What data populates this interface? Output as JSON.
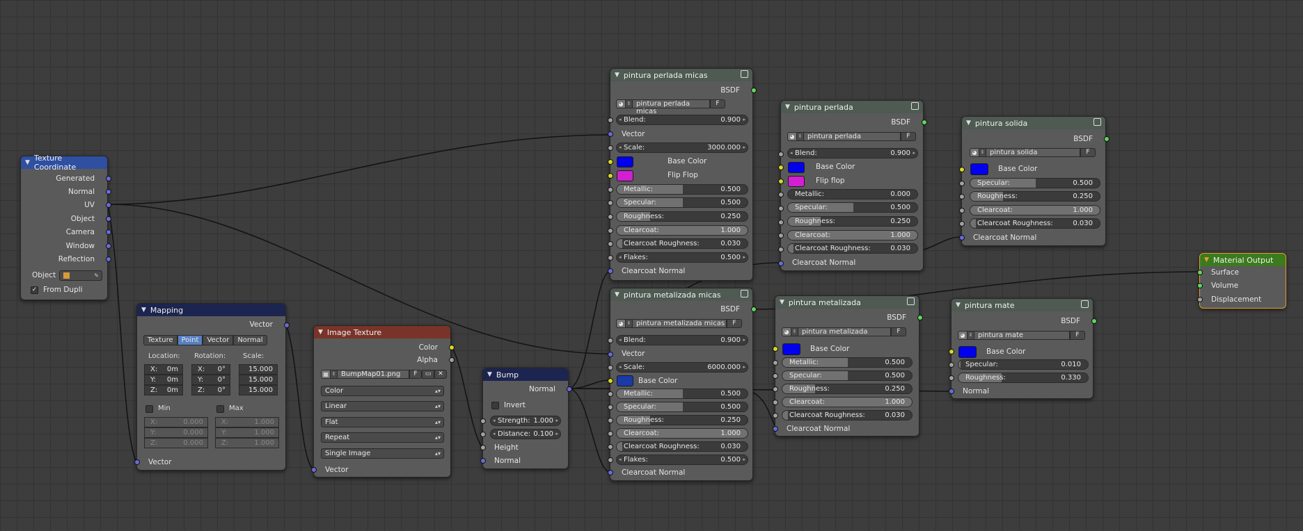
{
  "nodes": {
    "tex_coord": {
      "title": "Texture Coordinate",
      "outputs": [
        "Generated",
        "Normal",
        "UV",
        "Object",
        "Camera",
        "Window",
        "Reflection"
      ],
      "object_label": "Object",
      "from_dupli": "From Dupli"
    },
    "mapping": {
      "title": "Mapping",
      "output": "Vector",
      "tabs": [
        "Texture",
        "Point",
        "Vector",
        "Normal"
      ],
      "active_tab": "Point",
      "col_labels": [
        "Location:",
        "Rotation:",
        "Scale:"
      ],
      "location": [
        [
          "X:",
          "0m"
        ],
        [
          "Y:",
          "0m"
        ],
        [
          "Z:",
          "0m"
        ]
      ],
      "rotation": [
        [
          "X:",
          "0°"
        ],
        [
          "Y:",
          "0°"
        ],
        [
          "Z:",
          "0°"
        ]
      ],
      "scale": [
        "15.000",
        "15.000",
        "15.000"
      ],
      "min_label": "Min",
      "max_label": "Max",
      "min": [
        [
          "X:",
          "0.000"
        ],
        [
          "Y:",
          "0.000"
        ],
        [
          "Z:",
          "0.000"
        ]
      ],
      "max": [
        [
          "X:",
          "1.000"
        ],
        [
          "Y:",
          "1.000"
        ],
        [
          "Z:",
          "1.000"
        ]
      ],
      "input": "Vector"
    },
    "image_texture": {
      "title": "Image Texture",
      "outputs": [
        "Color",
        "Alpha"
      ],
      "image": "BumpMap01.png",
      "fake_user": "F",
      "dropdowns": [
        "Color",
        "Linear",
        "Flat",
        "Repeat",
        "Single Image"
      ],
      "input": "Vector"
    },
    "bump": {
      "title": "Bump",
      "output": "Normal",
      "invert": "Invert",
      "strength_label": "Strength:",
      "strength": "1.000",
      "distance_label": "Distance:",
      "distance": "0.100",
      "inputs": [
        "Height",
        "Normal"
      ]
    },
    "perlada_micas": {
      "title": "pintura perlada micas",
      "output": "BSDF",
      "group": "pintura perlada micas",
      "fake_user": "F",
      "blend": [
        "Blend:",
        "0.900"
      ],
      "vector": "Vector",
      "scale": [
        "Scale:",
        "3000.000"
      ],
      "base_color": "Base Color",
      "flip_flop": "Flip Flop",
      "metallic": [
        "Metallic:",
        "0.500"
      ],
      "specular": [
        "Specular:",
        "0.500"
      ],
      "roughness": [
        "Roughness:",
        "0.250"
      ],
      "clearcoat": [
        "Clearcoat:",
        "1.000"
      ],
      "clearcoat_roughness": [
        "Clearcoat Roughness:",
        "0.030"
      ],
      "flakes": [
        "Flakes:",
        "0.500"
      ],
      "clearcoat_normal": "Clearcoat Normal"
    },
    "metalizada_micas": {
      "title": "pintura metalizada micas",
      "output": "BSDF",
      "group": "pintura metalizada micas",
      "fake_user": "F",
      "blend": [
        "Blend:",
        "0.900"
      ],
      "vector": "Vector",
      "scale": [
        "Scale:",
        "6000.000"
      ],
      "base_color": "Base Color",
      "metallic": [
        "Metallic:",
        "0.500"
      ],
      "specular": [
        "Specular:",
        "0.500"
      ],
      "roughness": [
        "Roughness:",
        "0.250"
      ],
      "clearcoat": [
        "Clearcoat:",
        "1.000"
      ],
      "clearcoat_roughness": [
        "Clearcoat Roughness:",
        "0.030"
      ],
      "flakes": [
        "Flakes:",
        "0.500"
      ],
      "clearcoat_normal": "Clearcoat Normal"
    },
    "perlada": {
      "title": "pintura perlada",
      "output": "BSDF",
      "group": "pintura perlada",
      "fake_user": "F",
      "blend": [
        "Blend:",
        "0.900"
      ],
      "base_color": "Base Color",
      "flip_flop": "Flip flop",
      "metallic": [
        "Metallic:",
        "0.000"
      ],
      "specular": [
        "Specular:",
        "0.500"
      ],
      "roughness": [
        "Roughness:",
        "0.250"
      ],
      "clearcoat": [
        "Clearcoat:",
        "1.000"
      ],
      "clearcoat_roughness": [
        "Clearcoat Roughness:",
        "0.030"
      ],
      "clearcoat_normal": "Clearcoat Normal"
    },
    "metalizada": {
      "title": "pintura metalizada",
      "output": "BSDF",
      "group": "pintura metalizada",
      "fake_user": "F",
      "base_color": "Base Color",
      "metallic": [
        "Metallic:",
        "0.500"
      ],
      "specular": [
        "Specular:",
        "0.500"
      ],
      "roughness": [
        "Roughness:",
        "0.250"
      ],
      "clearcoat": [
        "Clearcoat:",
        "1.000"
      ],
      "clearcoat_roughness": [
        "Clearcoat Roughness:",
        "0.030"
      ],
      "clearcoat_normal": "Clearcoat Normal"
    },
    "solida": {
      "title": "pintura solida",
      "output": "BSDF",
      "group": "pintura solida",
      "fake_user": "F",
      "base_color": "Base Color",
      "specular": [
        "Specular:",
        "0.500"
      ],
      "roughness": [
        "Roughness:",
        "0.250"
      ],
      "clearcoat": [
        "Clearcoat:",
        "1.000"
      ],
      "clearcoat_roughness": [
        "Clearcoat Roughness:",
        "0.030"
      ],
      "clearcoat_normal": "Clearcoat Normal"
    },
    "mate": {
      "title": "pintura mate",
      "output": "BSDF",
      "group": "pintura mate",
      "fake_user": "F",
      "base_color": "Base Color",
      "specular": [
        "Specular:",
        "0.010"
      ],
      "roughness": [
        "Roughness:",
        "0.330"
      ],
      "normal": "Normal"
    },
    "material_output": {
      "title": "Material Output",
      "inputs": [
        "Surface",
        "Volume",
        "Displacement"
      ]
    }
  },
  "colors": {
    "base_blue": "#0000ee",
    "base_dark_blue": "#1a3aa8",
    "flip_magenta": "#d21fd2",
    "vector_socket": "#6a6ad9",
    "color_socket": "#d6d62a",
    "value_socket": "#a1a1a1",
    "shader_socket": "#5fd65f"
  }
}
